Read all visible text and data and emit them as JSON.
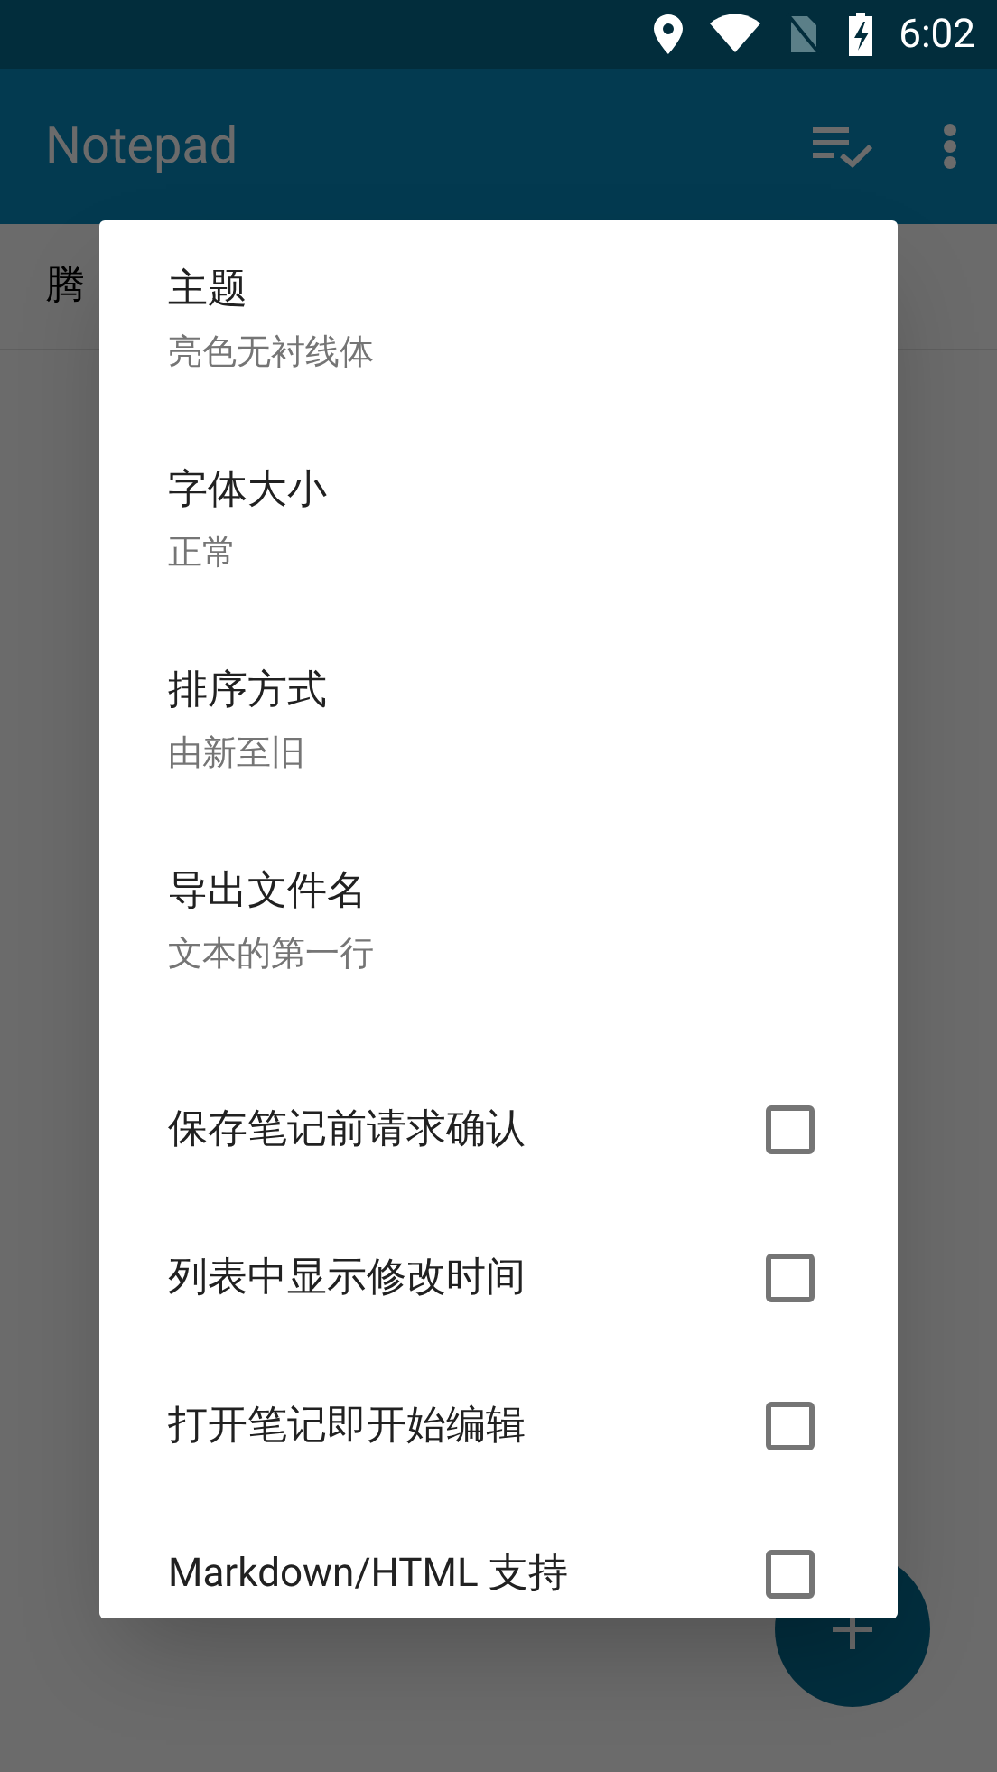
{
  "status_bar": {
    "time": "6:02"
  },
  "app_bar": {
    "title": "Notepad"
  },
  "notes": [
    {
      "title": "腾"
    }
  ],
  "dialog": {
    "items": [
      {
        "kind": "option",
        "title": "主题",
        "summary": "亮色无衬线体"
      },
      {
        "kind": "option",
        "title": "字体大小",
        "summary": "正常"
      },
      {
        "kind": "option",
        "title": "排序方式",
        "summary": "由新至旧"
      },
      {
        "kind": "option",
        "title": "导出文件名",
        "summary": "文本的第一行"
      },
      {
        "kind": "checkbox",
        "title": "保存笔记前请求确认",
        "checked": false
      },
      {
        "kind": "checkbox",
        "title": "列表中显示修改时间",
        "checked": false
      },
      {
        "kind": "checkbox",
        "title": "打开笔记即开始编辑",
        "checked": false
      },
      {
        "kind": "checkbox",
        "title": "Markdown/HTML 支持",
        "checked": false
      }
    ]
  }
}
